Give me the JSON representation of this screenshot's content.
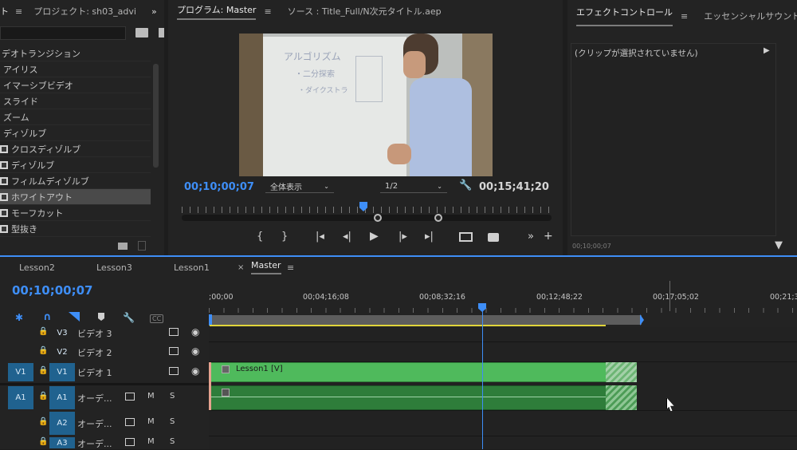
{
  "effects_panel": {
    "title_fragment": "ト",
    "project_tab": "プロジェクト: sh03_advi",
    "category": "デオトランジション",
    "items": [
      {
        "label": "アイリス",
        "check": false
      },
      {
        "label": "イマーシブビデオ",
        "check": false
      },
      {
        "label": "スライド",
        "check": false
      },
      {
        "label": "ズーム",
        "check": false
      },
      {
        "label": "ディゾルブ",
        "check": false
      },
      {
        "label": "クロスディゾルブ",
        "check": true
      },
      {
        "label": "ディゾルブ",
        "check": true
      },
      {
        "label": "フィルムディゾルブ",
        "check": true
      },
      {
        "label": "ホワイトアウト",
        "check": true,
        "selected": true
      },
      {
        "label": "モーフカット",
        "check": true
      },
      {
        "label": "型抜き",
        "check": true
      }
    ]
  },
  "program_monitor": {
    "tab_program": "プログラム: Master",
    "tab_source": "ソース : Title_Full/N次元タイトル.aep",
    "current_time": "00;10;00;07",
    "fit": "全体表示",
    "resolution": "1/2",
    "duration": "00;15;41;20",
    "whiteboard_title": "アルゴリズム",
    "whiteboard_line1": "・二分探索",
    "whiteboard_line2": "・ダイクストラ"
  },
  "effect_controls": {
    "tab1": "エフェクトコントロール",
    "tab2": "エッセンシャルサウンド",
    "no_clip": "(クリップが選択されていません)",
    "timecode": "00;10;00;07"
  },
  "timeline": {
    "tabs": [
      "Lesson2",
      "Lesson3",
      "Lesson1",
      "Master"
    ],
    "current_time": "00;10;00;07",
    "ruler_labels": [
      ";00;00",
      "00;04;16;08",
      "00;08;32;16",
      "00;12;48;22",
      "00;17;05;02",
      "00;21;3"
    ],
    "tracks": [
      {
        "target": "",
        "id": "V3",
        "name": "ビデオ 3"
      },
      {
        "target": "",
        "id": "V2",
        "name": "ビデオ 2"
      },
      {
        "target": "V1",
        "id": "V1",
        "name": "ビデオ 1"
      },
      {
        "target": "A1",
        "id": "A1",
        "name": "オーデ..."
      },
      {
        "target": "",
        "id": "A2",
        "name": "オーデ..."
      },
      {
        "target": "",
        "id": "A3",
        "name": "オーデ..."
      }
    ],
    "video_clip": "Lesson1 [V]",
    "m_label": "M",
    "s_label": "S",
    "cc_label": "CC"
  },
  "colors": {
    "accent_blue": "#3e8ef7",
    "clip_video": "#4fba5c",
    "clip_audio": "#2e7d3a",
    "target_blue": "#20628f"
  }
}
